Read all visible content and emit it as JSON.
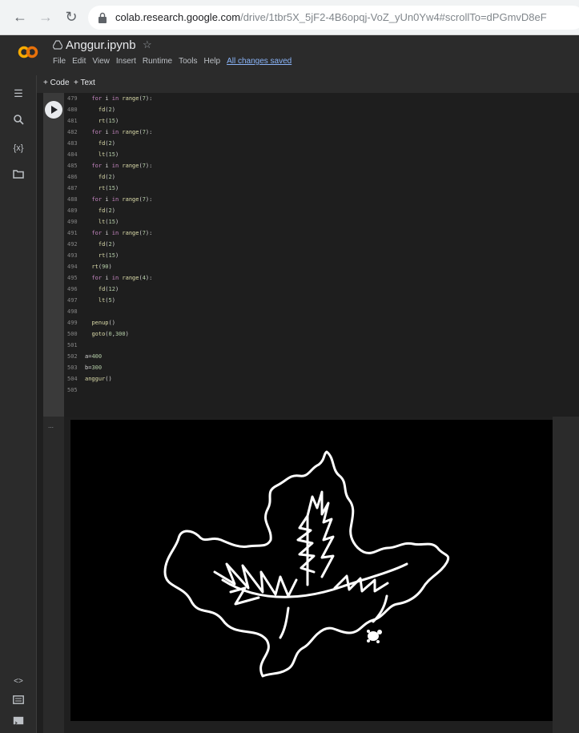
{
  "browser": {
    "url_domain": "colab.research.google.com",
    "url_path": "/drive/1tbr5X_5jF2-4B6opqj-VoZ_yUn0Yw4#scrollTo=dPGmvD8eF"
  },
  "header": {
    "title": "Anggur.ipynb",
    "menu": [
      "File",
      "Edit",
      "View",
      "Insert",
      "Runtime",
      "Tools",
      "Help"
    ],
    "saved_status": "All changes saved"
  },
  "toolbar": {
    "code_label": "+ Code",
    "text_label": "+ Text"
  },
  "code_lines": [
    {
      "n": "479",
      "code": "  for i in range(7):"
    },
    {
      "n": "480",
      "code": "    fd(2)"
    },
    {
      "n": "481",
      "code": "    rt(15)"
    },
    {
      "n": "482",
      "code": "  for i in range(7):"
    },
    {
      "n": "483",
      "code": "    fd(2)"
    },
    {
      "n": "484",
      "code": "    lt(15)"
    },
    {
      "n": "485",
      "code": "  for i in range(7):"
    },
    {
      "n": "486",
      "code": "    fd(2)"
    },
    {
      "n": "487",
      "code": "    rt(15)"
    },
    {
      "n": "488",
      "code": "  for i in range(7):"
    },
    {
      "n": "489",
      "code": "    fd(2)"
    },
    {
      "n": "490",
      "code": "    lt(15)"
    },
    {
      "n": "491",
      "code": "  for i in range(7):"
    },
    {
      "n": "492",
      "code": "    fd(2)"
    },
    {
      "n": "493",
      "code": "    rt(15)"
    },
    {
      "n": "494",
      "code": "  rt(90)"
    },
    {
      "n": "495",
      "code": "  for i in range(4):"
    },
    {
      "n": "496",
      "code": "    fd(12)"
    },
    {
      "n": "497",
      "code": "    lt(5)"
    },
    {
      "n": "498",
      "code": ""
    },
    {
      "n": "499",
      "code": "  penup()"
    },
    {
      "n": "500",
      "code": "  goto(0,300)"
    },
    {
      "n": "501",
      "code": ""
    },
    {
      "n": "502",
      "code": "a=400"
    },
    {
      "n": "503",
      "code": "b=300"
    },
    {
      "n": "504",
      "code": "anggur()"
    },
    {
      "n": "505",
      "code": ""
    }
  ],
  "colors": {
    "keyword": "#c586c0",
    "function": "#dcdcaa",
    "number": "#b5cea8",
    "text": "#d4d4d4",
    "drawing_stroke": "#ffffff"
  }
}
